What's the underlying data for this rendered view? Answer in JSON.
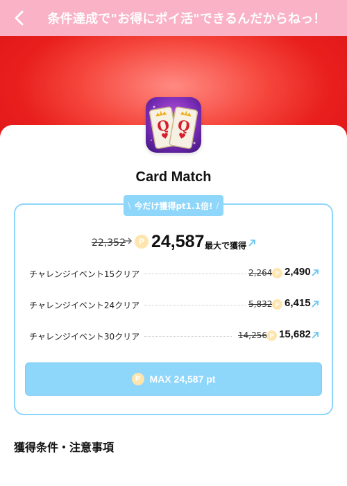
{
  "header": {
    "back_icon": "chevron-left-icon",
    "title": "条件達成で\"お得にポイ活\"できるんだからねっ！"
  },
  "colors": {
    "header_bg": "#f9b2c6",
    "hero_red": "#e81f1d",
    "accent_blue": "#8fd6fb",
    "coin": "#fde5ad"
  },
  "app": {
    "icon": "card-match-app-icon",
    "name": "Card Match"
  },
  "promo": {
    "slash_left": "\\",
    "label": "今だけ獲得pt1.1倍!",
    "slash_right": "/"
  },
  "total": {
    "old_points": "22,352",
    "coin_symbol": "P",
    "new_points": "24,587",
    "suffix": "最大で獲得"
  },
  "rewards": [
    {
      "label": "チャレンジイベント15クリア",
      "old": "2,264",
      "new": "2,490"
    },
    {
      "label": "チャレンジイベント24クリア",
      "old": "5,832",
      "new": "6,415"
    },
    {
      "label": "チャレンジイベント30クリア",
      "old": "14,256",
      "new": "15,682"
    }
  ],
  "max_button": {
    "label": "MAX 24,587 pt"
  },
  "conditions": {
    "title": "獲得条件・注意事項"
  }
}
